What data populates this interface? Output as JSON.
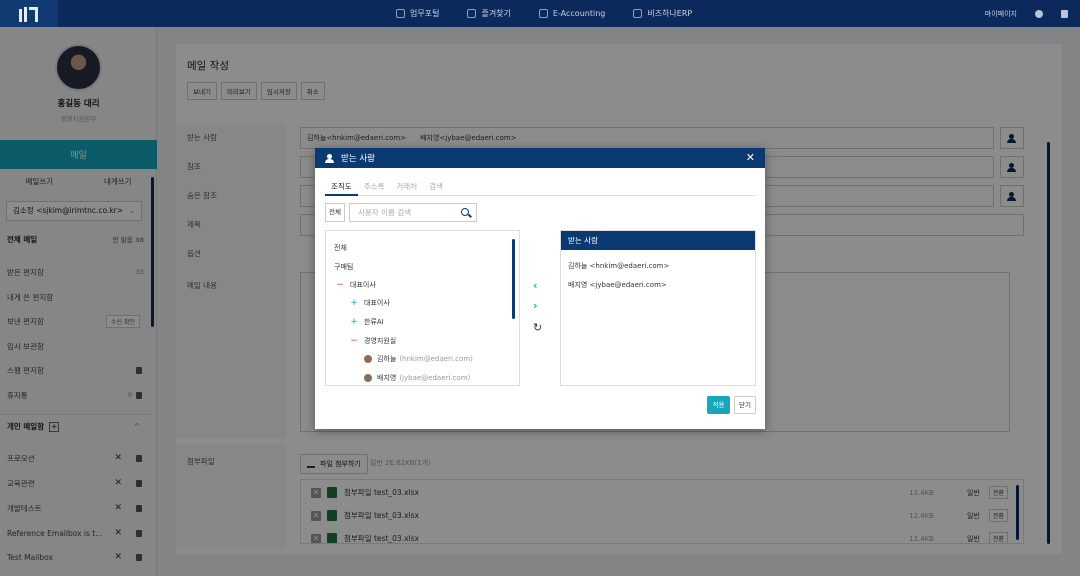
{
  "topnav": {
    "items": [
      "업무포털",
      "즐겨찾기",
      "E-Accounting",
      "비즈하나ERP"
    ],
    "mypage": "마이페이지"
  },
  "profile": {
    "name": "홍길동 대리",
    "dept": "경영지원본부"
  },
  "sidebar": {
    "mail_tab": "메일",
    "write": "메일쓰기",
    "write_self": "내게쓰기",
    "account": "김소정 <sjkim@irimtnc.co.kr>",
    "folders": [
      {
        "label": "전체 메일",
        "count": "안 읽음 38"
      },
      {
        "label": "받은 편지함",
        "count": "33"
      },
      {
        "label": "내게 쓴 편지함",
        "count": ""
      },
      {
        "label": "보낸 편지함",
        "badge": "수신 확인"
      },
      {
        "label": "임시 보관함",
        "count": ""
      },
      {
        "label": "스팸 편지함",
        "count": ""
      },
      {
        "label": "휴지통",
        "count": "9"
      }
    ],
    "personal_header": "개인 메일함",
    "personal": [
      "프로모션",
      "교육관련",
      "개발테스트",
      "Reference Emailbox is t...",
      "Test Mailbox"
    ]
  },
  "compose": {
    "title": "메일 작성",
    "toolbar": [
      "보내기",
      "미리보기",
      "임시저장",
      "취소"
    ],
    "labels": {
      "to": "받는 사람",
      "cc": "참조",
      "bcc": "숨은 참조",
      "subject": "제목",
      "options": "옵션",
      "body": "메일 내용",
      "attach": "첨부파일"
    },
    "recipients": [
      "김하늘<hnkim@edaeri.com>",
      "배지영<jybae@edaeri.com>"
    ],
    "attach_button": "파일 첨부하기",
    "attach_info": "일반 2E.62KB(1개)",
    "attachments": [
      {
        "name": "첨부파일 test_03.xlsx",
        "size": "12.4KB",
        "type": "일반",
        "conv": "전환"
      },
      {
        "name": "첨부파일 test_03.xlsx",
        "size": "12.4KB",
        "type": "일반",
        "conv": "전환"
      },
      {
        "name": "첨부파일 test_03.xlsx",
        "size": "12.4KB",
        "type": "일반",
        "conv": "전환"
      }
    ]
  },
  "modal": {
    "title": "받는 사람",
    "tabs": [
      "조직도",
      "주소록",
      "거래처",
      "검색"
    ],
    "scope": "전체",
    "search_placeholder": "사용자 이름 검색",
    "tree": {
      "root": "전체",
      "company": "구매팀",
      "ceo": "대표이사",
      "sub1": "대표이사",
      "sub2": "한류AI",
      "dept": "경영지원실",
      "user1_name": "김하늘",
      "user1_email": "(hnkim@edaeri.com)",
      "user2_name": "배지영",
      "user2_email": "(jybae@edaeri.com)"
    },
    "recipients_header": "받는 사람",
    "recipients": [
      "김하늘 <hnkim@edaeri.com>",
      "배지영 <jybae@edaeri.com>"
    ],
    "apply": "적용",
    "close": "닫기"
  }
}
